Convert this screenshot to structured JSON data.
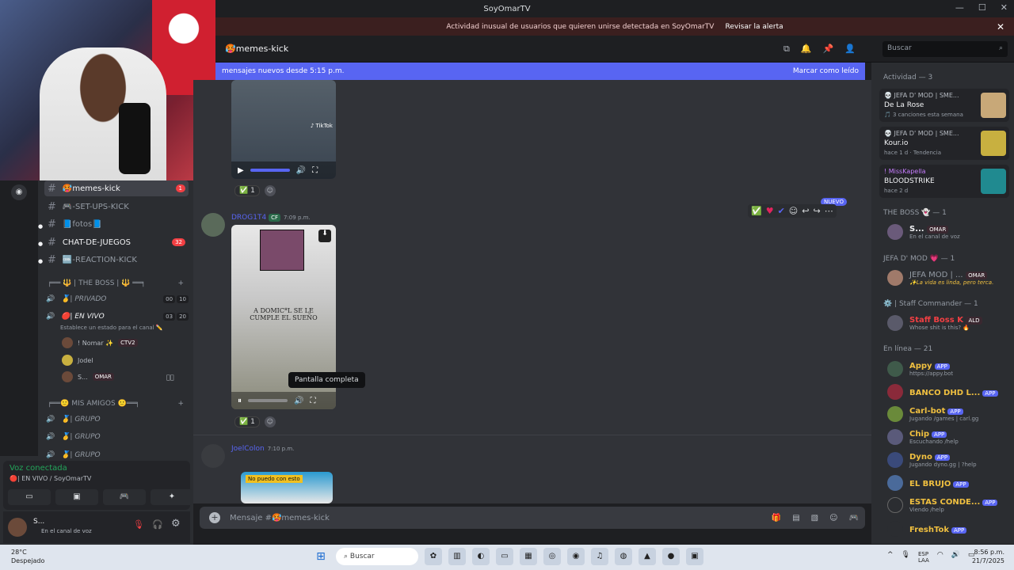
{
  "window": {
    "title": "SoyOmarTV"
  },
  "alert": {
    "text": "Actividad inusual de usuarios que quieren unirse detectada en SoyOmarTV",
    "action": "Revisar la alerta"
  },
  "header": {
    "channel": "🥵memes-kick",
    "search_placeholder": "Buscar"
  },
  "newbar": {
    "text": "mensajes nuevos desde 5:15 p.m.",
    "action": "Marcar como leído"
  },
  "sidebar": {
    "channels": [
      {
        "label": "🥵memes-kick",
        "badge": "1"
      },
      {
        "label": "🎮-SET-UPS-KICK"
      },
      {
        "label": "📘fotos📘"
      },
      {
        "label": "CHAT-DE-JUEGOS",
        "badge": "32"
      },
      {
        "label": "🆒-REACTION-KICK"
      }
    ],
    "cat1": "╒══ 🔱 | THE BOSS | 🔱 ══╕",
    "voice": [
      {
        "label": "🥇| PRIVADO",
        "a": "00",
        "b": "10"
      },
      {
        "label": "🔴| EN VIVO",
        "a": "03",
        "b": "20"
      }
    ],
    "status_hint": "Establece un estado para el canal ✏️",
    "vusers": [
      {
        "name": "! Nomar ✨",
        "tag": "CTV2"
      },
      {
        "name": "Jodel",
        "tag": ""
      },
      {
        "name": "S...",
        "tag": "OMAR"
      }
    ],
    "cat2": "╒══🙂 MIS AMIGOS 🙂══╕",
    "groups": [
      "🥇| GRUPO",
      "🥇| GRUPO",
      "🥇| GRUPO"
    ]
  },
  "voicepanel": {
    "title": "Voz conectada",
    "sub": "🔴| EN VIVO / SoyOmarTV"
  },
  "userpanel": {
    "name": "S...",
    "status": "En el canal de voz"
  },
  "messages": [
    {
      "author": "DROG1T4",
      "badge": "CF",
      "time": "7:09 p.m.",
      "caption": "A DOMIC*L SE LE CUMPLE EL SUEÑO",
      "reaction": "1"
    },
    {
      "author": "JoelColon",
      "time": "7:10 p.m.",
      "caption": "No puedo con esto"
    }
  ],
  "first_reaction": "1",
  "tooltip": "Pantalla completa",
  "new_label": "NUEVO",
  "input": {
    "placeholder": "Mensaje #🥵memes-kick"
  },
  "members": {
    "activity_head": "Actividad — 3",
    "activities": [
      {
        "name": "💀 JEFA D' MOD | SME...",
        "game": "De La Rose",
        "sub": "🎵 3 canciones esta semana"
      },
      {
        "name": "💀 JEFA D' MOD | SME...",
        "game": "Kour.io",
        "sub": "hace 1 d · Tendencia"
      },
      {
        "name": "! MissKapella",
        "game": "BLOODSTRIKE",
        "sub": "hace 2 d"
      }
    ],
    "boss_head": "THE BOSS 👻 — 1",
    "boss": {
      "name": "S...",
      "tag": "OMAR",
      "sub": "En el canal de voz"
    },
    "jefa_head": "JEFA D' MOD 💗 — 1",
    "jefa": {
      "name": "JEFA MOD | ...",
      "tag": "OMAR",
      "sub": "✨La vida es linda, pero terca."
    },
    "staff_head": "⚙️ | Staff Commander — 1",
    "staff": {
      "name": "Staff Boss K",
      "tag": "ALD",
      "sub": "Whose shit is this? 🔥"
    },
    "online_head": "En línea — 21",
    "online": [
      {
        "name": "Appy",
        "sub": "https://appy.bot",
        "color": "#f0c040"
      },
      {
        "name": "BANCO DHD L...",
        "sub": "",
        "color": "#f0c040"
      },
      {
        "name": "Carl-bot",
        "sub": "Jugando /games | carl.gg",
        "color": "#f0c040"
      },
      {
        "name": "Chip",
        "sub": "Escuchando /help",
        "color": "#f0c040"
      },
      {
        "name": "Dyno",
        "sub": "Jugando dyno.gg | ?help",
        "color": "#f0c040"
      },
      {
        "name": "EL BRUJO",
        "sub": "",
        "color": "#f0c040"
      },
      {
        "name": "ESTAS CONDE...",
        "sub": "Viendo /help",
        "color": "#f0c040"
      },
      {
        "name": "FreshTok",
        "sub": "",
        "color": "#f0c040"
      }
    ],
    "app_tag": "APP"
  },
  "taskbar": {
    "temp": "28°C",
    "weather": "Despejado",
    "search": "Buscar",
    "lang1": "ESP",
    "lang2": "LAA",
    "time": "8:56 p.m.",
    "date": "21/7/2025"
  }
}
